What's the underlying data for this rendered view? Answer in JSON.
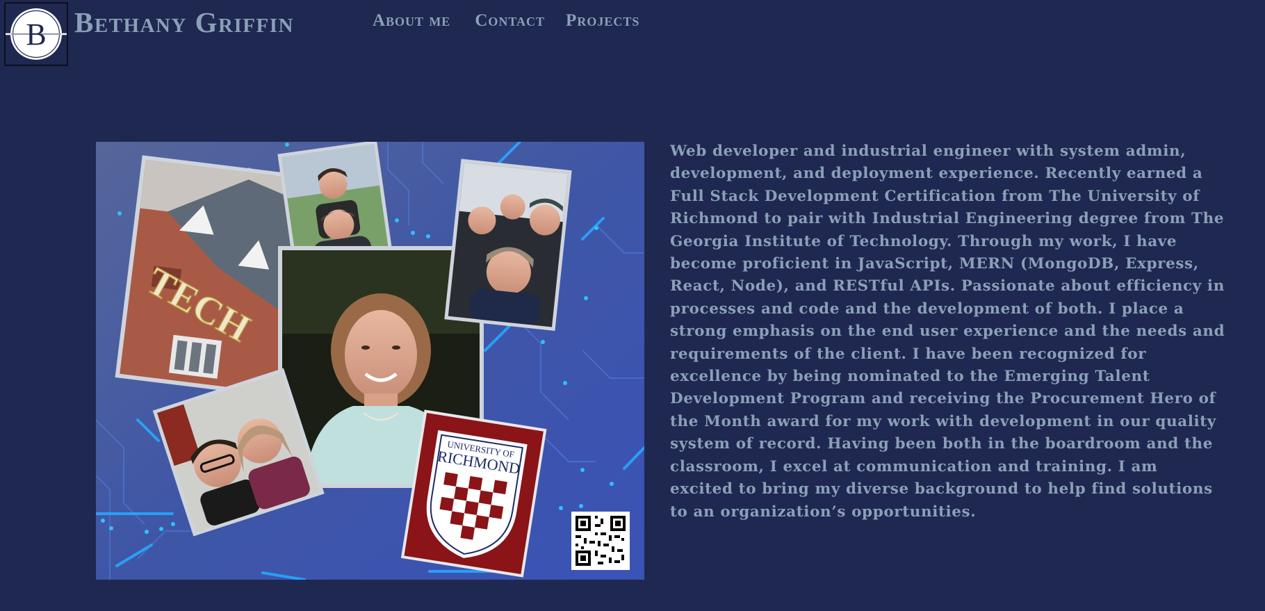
{
  "header": {
    "logo_letter": "B",
    "site_name": "Bethany Griffin",
    "nav": [
      {
        "label": "About me"
      },
      {
        "label": "Contact"
      },
      {
        "label": "Projects"
      }
    ]
  },
  "collage": {
    "tech_sign": "TECH",
    "ur_seal_line1": "UNIVERSITY OF",
    "ur_seal_line2": "RICHMOND"
  },
  "bio": {
    "text": "Web developer and industrial engineer with system admin, development, and deployment experience. Recently earned a Full Stack Development Certification from The University of Richmond to pair with Industrial Engineering degree from The Georgia Institute of Technology. Through my work, I have become proficient in JavaScript, MERN (MongoDB, Express, React, Node), and RESTful APIs. Passionate about efficiency in processes and code and the development of both. I place a strong emphasis on the end user experience and the needs and requirements of the client. I have been recognized for excellence by being nominated to the Emerging Talent Development Program and receiving the Procurement Hero of the Month award for my work with development in our quality system of record. Having been both in the boardroom and the classroom, I excel at communication and training. I am excited to bring my diverse background to help find solutions to an organization’s opportunities."
  },
  "colors": {
    "background": "#1f2850",
    "text": "#8aa0b8",
    "circuit_glow": "#1e90ff"
  }
}
